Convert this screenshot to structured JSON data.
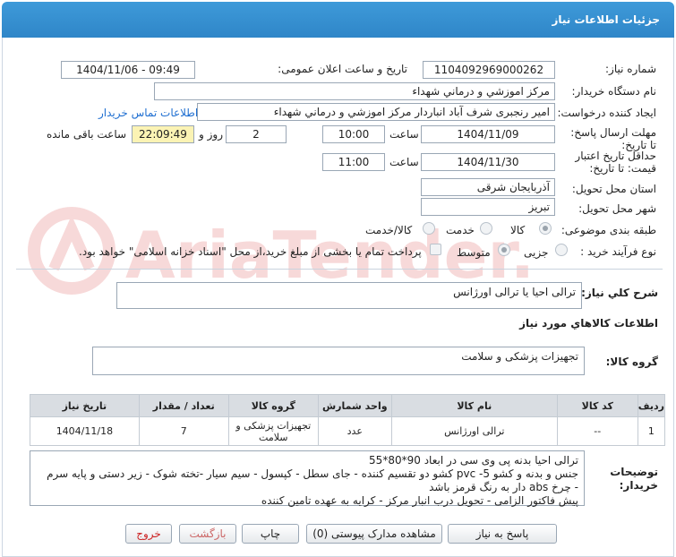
{
  "header": {
    "title": "جزئیات اطلاعات نیاز"
  },
  "labels": {
    "need_number": "شماره نیاز:",
    "announce_datetime": "تاریخ و ساعت اعلان عمومی:",
    "buyer_org": "نام دستگاه خریدار:",
    "requester": "ایجاد کننده درخواست:",
    "contact_link": "اطلاعات تماس خریدار",
    "deadline": "مهلت ارسال پاسخ: تا تاریخ:",
    "hour": "ساعت",
    "day_and": "روز و",
    "remaining": "ساعت باقی مانده",
    "validity": "حداقل تاریخ اعتبار قیمت: تا تاریخ:",
    "province": "استان محل تحویل:",
    "city": "شهر محل تحویل:",
    "category": "طبقه بندی موضوعی:",
    "process_type": "نوع فرآیند خرید :",
    "general_desc": "شرح کلي نياز:",
    "goods_info": "اطلاعات كالاهاي مورد نياز",
    "goods_group": "گروه کالا:",
    "buyer_notes": "توضیحات خریدار:"
  },
  "fields": {
    "need_number": "1104092969000262",
    "announce_datetime": "1404/11/06 - 09:49",
    "buyer_org": "مرکز اموزشي و درماني شهداء",
    "requester": "امیر رنجبری شرف آباد انباردار مرکز اموزشي و درماني شهداء",
    "deadline_date": "1404/11/09",
    "deadline_time": "10:00",
    "days": "2",
    "remaining_time": "22:09:49",
    "validity_date": "1404/11/30",
    "validity_time": "11:00",
    "province": "آذربایجان شرقی",
    "city": "تبریز",
    "general_desc": "ترالی احیا یا ترالی اورژانس",
    "goods_group": "تجهیزات پزشکی و سلامت",
    "buyer_notes": [
      "ترالی احیا بدنه پی وی سی در ابعاد 90*80*55",
      "جنس و بدنه و کشو pvc -5 کشو دو تقسیم کننده - جای سطل - کپسول - سیم سیار  -تخته شوک - زیر دستی و پایه سرم",
      "- چرخ abs دار به رنگ قرمز باشد",
      "پیش فاکتور الزامی - تحویل درب انبار مرکز - کرایه به عهده تامین کننده"
    ]
  },
  "category_options": [
    "کالا",
    "خدمت",
    "کالا/خدمت"
  ],
  "category_selected": "کالا",
  "process_options": [
    "جزیی",
    "متوسط"
  ],
  "process_selected": "جزیی",
  "payment_note": "پرداخت تمام یا بخشی از مبلغ خرید،از محل \"اسناد خزانه اسلامی\" خواهد بود.",
  "table": {
    "headers": [
      "ردیف",
      "کد کالا",
      "نام کالا",
      "واحد شمارش",
      "گروه کالا",
      "تعداد / مقدار",
      "تاریخ نیاز"
    ],
    "rows": [
      [
        "1",
        "--",
        "ترالی اورژانس",
        "عدد",
        "تجهیزات پزشکی و سلامت",
        "7",
        "1404/11/18"
      ]
    ]
  },
  "buttons": {
    "reply": "پاسخ به نیاز",
    "attachments": "مشاهده مدارک پیوستی (0)",
    "print": "چاپ",
    "back": "بازگشت",
    "exit": "خروج"
  },
  "watermark": "AriaTender.net",
  "colors": {
    "header": "#3e9ad9",
    "link": "#1f6fd1",
    "exit": "#cc2222"
  }
}
